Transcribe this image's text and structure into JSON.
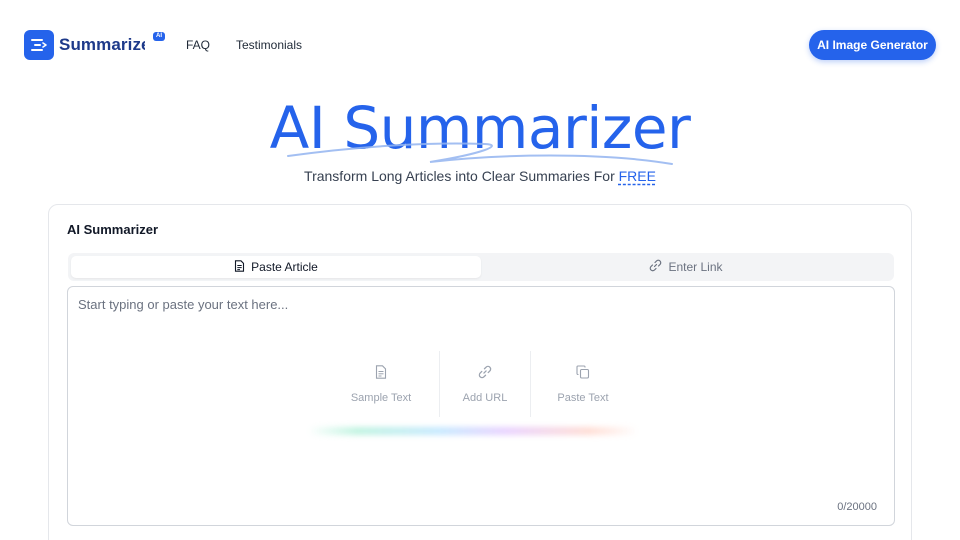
{
  "header": {
    "logo_text": "Summarizer",
    "logo_badge": "AI",
    "nav": [
      {
        "label": "FAQ"
      },
      {
        "label": "Testimonials"
      }
    ],
    "cta_label": "AI Image Generator"
  },
  "hero": {
    "title": "AI Summarizer",
    "subtitle_prefix": "Transform Long Articles into Clear Summaries For ",
    "subtitle_highlight": "FREE"
  },
  "card": {
    "title": "AI Summarizer",
    "tabs": [
      {
        "label": "Paste Article",
        "icon": "document-icon",
        "active": true
      },
      {
        "label": "Enter Link",
        "icon": "link-icon",
        "active": false
      }
    ],
    "input": {
      "placeholder": "Start typing or paste your text here...",
      "value": ""
    },
    "quick_actions": [
      {
        "label": "Sample Text",
        "icon": "document-icon"
      },
      {
        "label": "Add URL",
        "icon": "link-icon"
      },
      {
        "label": "Paste Text",
        "icon": "copy-icon"
      }
    ],
    "counter": "0/20000"
  },
  "colors": {
    "accent": "#2563eb",
    "logo_text": "#1e3a8a"
  }
}
